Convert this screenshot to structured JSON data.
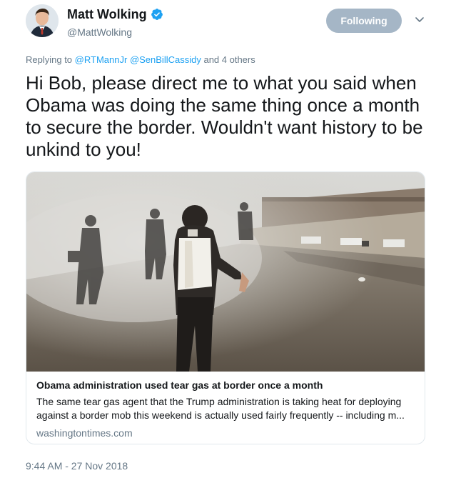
{
  "author": {
    "name": "Matt Wolking",
    "handle": "@MattWolking",
    "verified": true
  },
  "follow_button": {
    "label": "Following"
  },
  "reply": {
    "prefix": "Replying to",
    "mention_1": "@RTMannJr",
    "mention_2": "@SenBillCassidy",
    "suffix": "and 4 others"
  },
  "tweet": {
    "text": "Hi Bob, please direct me to what you said when Obama was doing the same thing once a month to secure the border. Wouldn't want history to be unkind to you!"
  },
  "card": {
    "title": "Obama administration used tear gas at border once a month",
    "description": "The same tear gas agent that the Trump administration is taking heat for deploying against a border mob this weekend is actually used fairly frequently -- including m...",
    "domain": "washingtontimes.com",
    "image_icon": "photo-image"
  },
  "timestamp": "9:44 AM - 27 Nov 2018",
  "colors": {
    "accent": "#1da1f2",
    "follow_button_bg": "#a5b6c6",
    "secondary_text": "#657786",
    "border": "#e1e8ed"
  },
  "icons": [
    "verified-badge-icon",
    "chevron-down-icon",
    "avatar-photo"
  ]
}
